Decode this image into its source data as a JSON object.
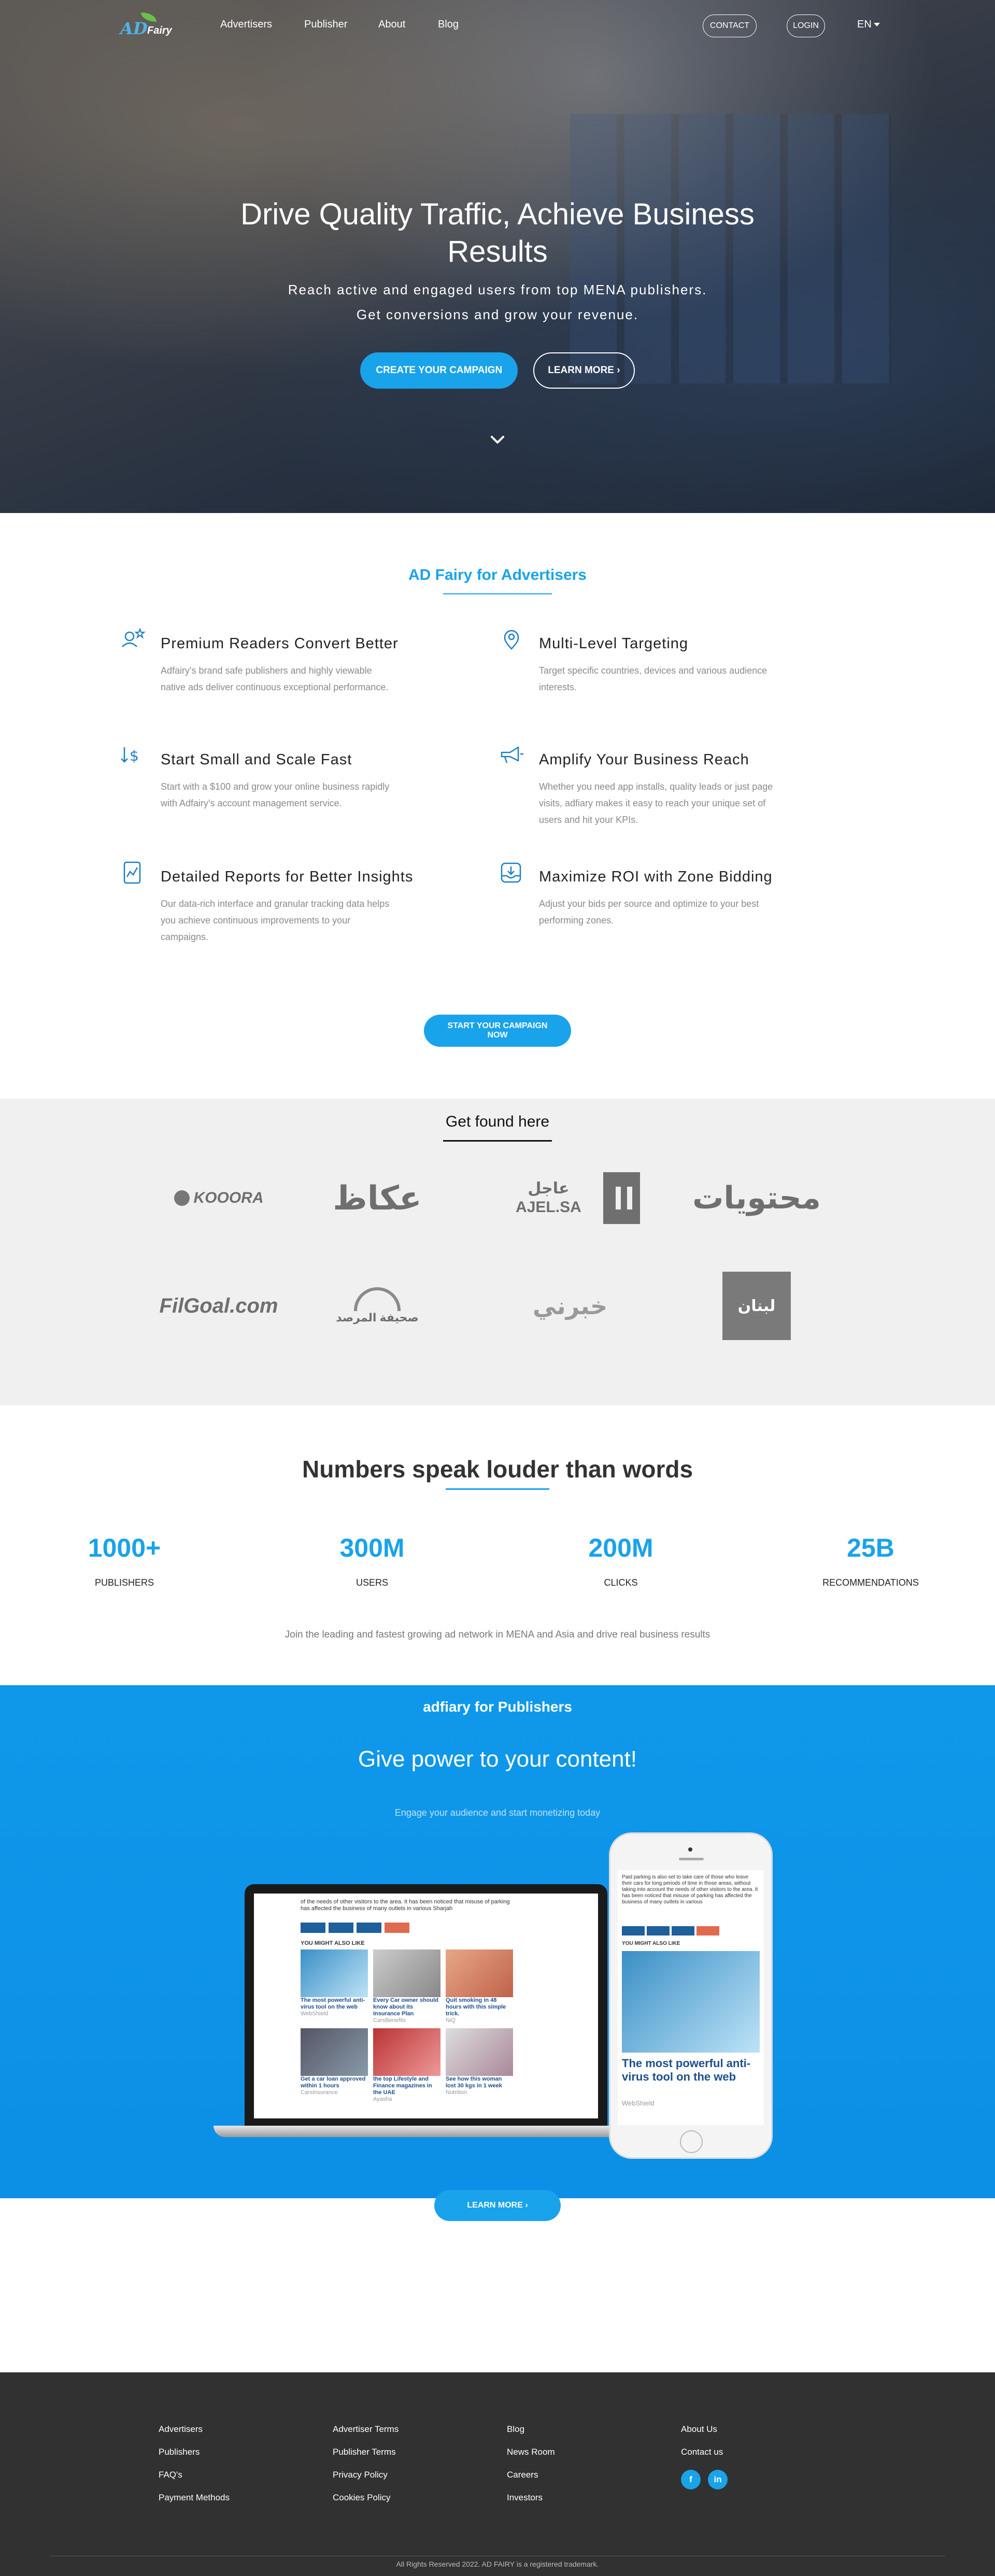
{
  "nav": {
    "logo_ad": "AD",
    "logo_fairy": "Fairy",
    "links": [
      "Advertisers",
      "Publisher",
      "About",
      "Blog"
    ],
    "contact": "CONTACT",
    "login": "LOGIN",
    "lang": "EN"
  },
  "hero": {
    "title": "Drive Quality Traffic, Achieve Business Results",
    "sub1": "Reach active and engaged users from top MENA publishers.",
    "sub2": "Get conversions and grow your revenue.",
    "cta": "CREATE YOUR CAMPAIGN",
    "more": "LEARN MORE"
  },
  "advertisers": {
    "title": "AD Fairy for Advertisers",
    "features": [
      {
        "icon": "users-star-icon",
        "title": "Premium Readers Convert Better",
        "text": "Adfairy's brand safe publishers and highly viewable native ads deliver continuous exceptional performance."
      },
      {
        "icon": "location-pin-icon",
        "title": "Multi-Level Targeting",
        "text": "Target specific countries, devices and various audience interests."
      },
      {
        "icon": "dollar-arrow-icon",
        "title": "Start Small and Scale Fast",
        "text": "Start with a $100 and grow your online business rapidly with Adfairy's account management service."
      },
      {
        "icon": "megaphone-icon",
        "title": "Amplify Your Business Reach",
        "text": "Whether you need app installs, quality leads or just page visits, adfiary makes it easy to reach your unique set of users and hit your KPIs."
      },
      {
        "icon": "report-chart-icon",
        "title": "Detailed Reports for Better Insights",
        "text": "Our data-rich interface and granular tracking data helps you achieve continuous improvements to your campaigns."
      },
      {
        "icon": "inbox-download-icon",
        "title": "Maximize ROI with Zone Bidding",
        "text": "Adjust your bids per source and optimize to your best performing zones."
      }
    ],
    "cta": "START YOUR CAMPAIGN NOW"
  },
  "found": {
    "title": "Get found here",
    "logos": [
      "KOOORA",
      "عكاظ",
      "عاجل AJEL.SA",
      "محتويات",
      "FilGoal.com",
      "صحيفة المرصد",
      "خبرني",
      "لبنان"
    ]
  },
  "numbers": {
    "title": "Numbers speak louder than words",
    "stats": [
      {
        "value": "1000+",
        "label": "PUBLISHERS"
      },
      {
        "value": "300M",
        "label": "USERS"
      },
      {
        "value": "200M",
        "label": "CLICKS"
      },
      {
        "value": "25B",
        "label": "RECOMMENDATIONS"
      }
    ],
    "footer": "Join the leading and fastest growing ad network in MENA and Asia and drive real business results"
  },
  "publishers": {
    "small_title": "adfiary for Publishers",
    "title": "Give power to your content!",
    "sub": "Engage your audience and start monetizing today",
    "laptop_text": "of the needs of other visitors to the area. It has been noticed that misuse of parking has affected the business of many outlets in various Sharjah",
    "you_might": "YOU MIGHT ALSO LIKE",
    "cards": [
      {
        "title": "The most powerful anti-virus tool on the web",
        "src": "WebShield"
      },
      {
        "title": "Every Car owner should know about its Insurance Plan",
        "src": "CarsBenefits"
      },
      {
        "title": "Quit smoking in 48 hours with this simple trick.",
        "src": "NiQ"
      },
      {
        "title": "Get a car loan approved within 1 hours",
        "src": "CarsInsurance"
      },
      {
        "title": "the top Lifestyle and Finance magazines in the UAE",
        "src": "Ayasha"
      },
      {
        "title": "See how this woman lost 30 kgs in 1 week",
        "src": "Nutrition"
      }
    ],
    "phone_text": "Paid parking is also set to take care of those who leave their cars for long periods of time in those areas, without taking into account the needs of other visitors to the area. It has been noticed that misuse of parking has affected the business of many outlets in various",
    "phone_card_title": "The most powerful anti-virus tool on the web",
    "phone_card_src": "WebShield",
    "cta": "LEARN MORE"
  },
  "footer": {
    "col1": [
      "Advertisers",
      "Publishers",
      "FAQ's",
      "Payment Methods"
    ],
    "col2": [
      "Advertiser Terms",
      "Publisher Terms",
      "Privacy Policy",
      "Cookies Policy"
    ],
    "col3": [
      "Blog",
      "News Room",
      "Careers",
      "Investors"
    ],
    "col4": [
      "About Us",
      "Contact us"
    ],
    "copyright": "All Rights Reserved 2022. AD FAIRY is a registered trademark."
  }
}
